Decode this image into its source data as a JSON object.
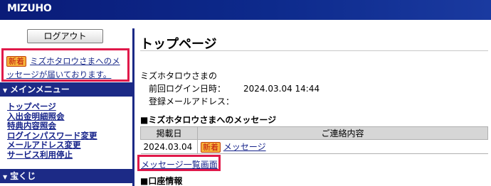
{
  "header": {
    "logo": "MIZUHO"
  },
  "sidebar": {
    "logout_label": "ログアウト",
    "notice": {
      "badge": "新着",
      "text": "ミズホタロウさまへのメッセージが届いております。"
    },
    "main_menu_title": "メインメニュー",
    "menu_items": [
      {
        "label": "トップページ"
      },
      {
        "label": "入出金明細照会"
      },
      {
        "label": "特典内容照会"
      },
      {
        "label": "ログインパスワード変更"
      },
      {
        "label": "メールアドレス変更"
      },
      {
        "label": "サービス利用停止"
      }
    ],
    "lottery_title": "宝くじ"
  },
  "main": {
    "title": "トップページ",
    "greeting": "ミズホタロウさまの",
    "last_login_label": "前回ログイン日時：",
    "last_login_value": "2024.03.04 14:44",
    "email_label": "登録メールアドレス：",
    "email_value": "",
    "messages_section_title": "■ミズホタロウさまへのメッセージ",
    "table": {
      "headers": [
        "掲載日",
        "ご連絡内容"
      ],
      "rows": [
        {
          "date": "2024.03.04",
          "badge": "新着",
          "content": "メッセージ"
        }
      ]
    },
    "message_list_link": "メッセージ一覧画面",
    "account_section_title": "■口座情報"
  },
  "colors": {
    "nav_blue": "#1c2a86",
    "highlight_red": "#e0194a",
    "badge_orange": "#f6b23c"
  }
}
